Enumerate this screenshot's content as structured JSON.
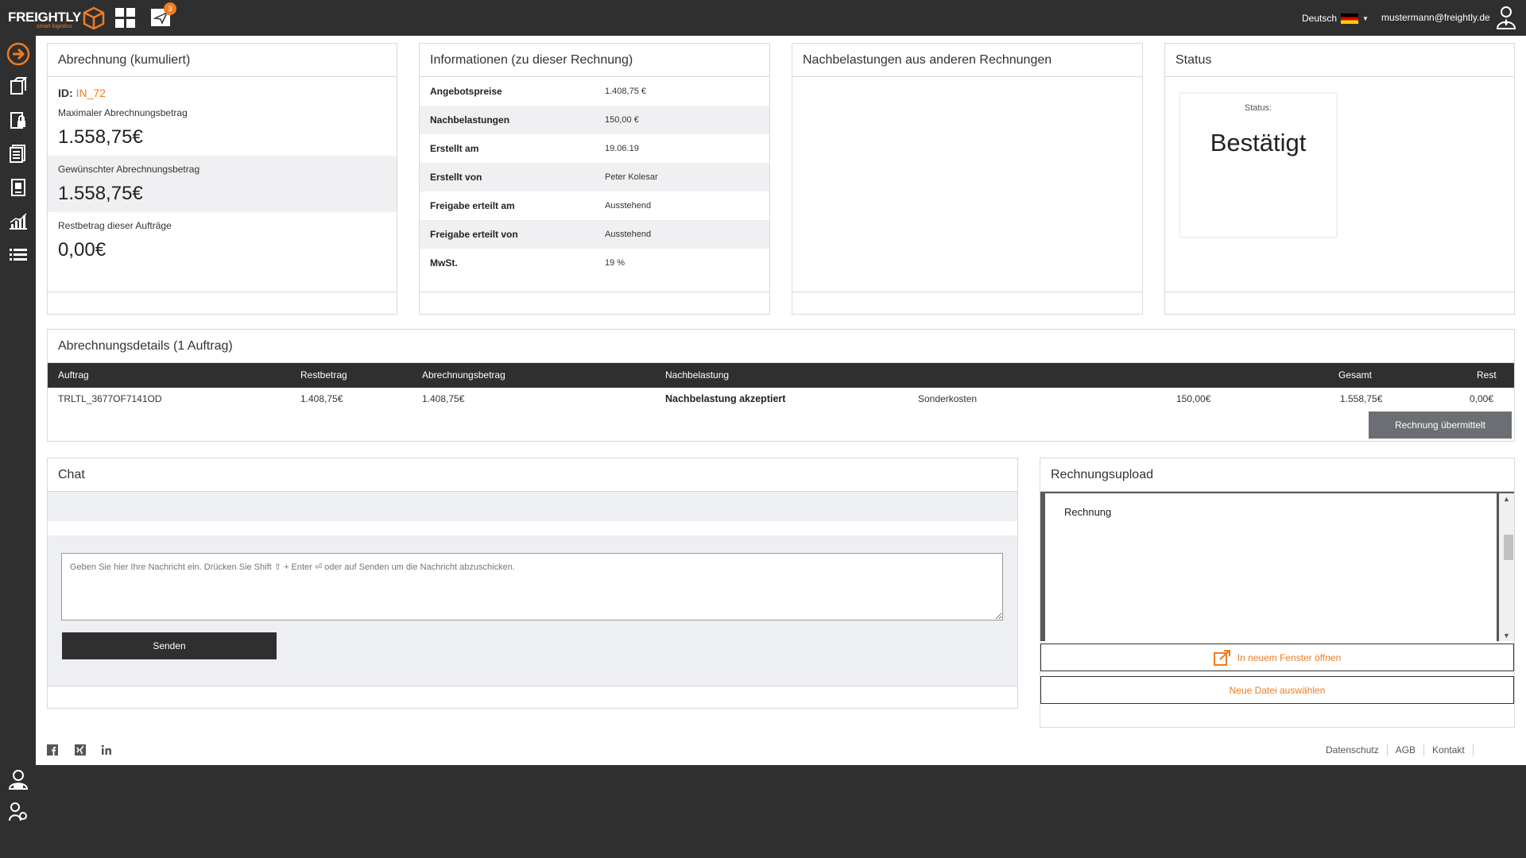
{
  "brand": {
    "name": "FREIGHTLY",
    "tagline": "smart logistics",
    "accent": "#ef7b22",
    "dark": "#2f2f2f"
  },
  "topbar": {
    "notifications_count": "3",
    "language": "Deutsch",
    "user_email": "mustermann@freightly.de"
  },
  "sidebar": {
    "icons": [
      "arrow-right-circle-icon",
      "shipment-icon",
      "lock-document-icon",
      "documents-icon",
      "invoice-icon",
      "chart-icon",
      "list-icon",
      "user-manager-icon",
      "user-settings-icon"
    ]
  },
  "abrechnung": {
    "title": "Abrechnung (kumuliert)",
    "id_label": "ID:",
    "id_value": "IN_72",
    "max_label": "Maximaler Abrechnungsbetrag",
    "max_value": "1.558,75€",
    "wanted_label": "Gewünschter Abrechnungsbetrag",
    "wanted_value": "1.558,75€",
    "rest_label": "Restbetrag dieser Aufträge",
    "rest_value": "0,00€"
  },
  "informationen": {
    "title": "Informationen (zu dieser Rechnung)",
    "rows": [
      {
        "label": "Angebotspreise",
        "value": "1.408,75 €"
      },
      {
        "label": "Nachbelastungen",
        "value": "150,00 €"
      },
      {
        "label": "Erstellt am",
        "value": "19.06.19"
      },
      {
        "label": "Erstellt von",
        "value": "Peter Kolesar"
      },
      {
        "label": "Freigabe erteilt am",
        "value": "Ausstehend"
      },
      {
        "label": "Freigabe erteilt von",
        "value": "Ausstehend"
      },
      {
        "label": "MwSt.",
        "value": "19 %"
      }
    ]
  },
  "nachbelastungen": {
    "title": "Nachbelastungen aus anderen Rechnungen"
  },
  "status": {
    "title": "Status",
    "label": "Status:",
    "value": "Bestätigt"
  },
  "details": {
    "title": "Abrechnungsdetails (1 Auftrag)",
    "columns": {
      "auftrag": "Auftrag",
      "restbetrag": "Restbetrag",
      "abrechnungsbetrag": "Abrechnungsbetrag",
      "nachbelastung": "Nachbelastung",
      "gesamt": "Gesamt",
      "rest": "Rest"
    },
    "row": {
      "auftrag": "TRLTL_3677OF7141OD",
      "restbetrag": "1.408,75€",
      "abrechnungsbetrag": "1.408,75€",
      "nachbelastung_status": "Nachbelastung akzeptiert",
      "nachbelastung_typ": "Sonderkosten",
      "nachbelastung_betrag": "150,00€",
      "gesamt": "1.558,75€",
      "rest": "0,00€"
    },
    "button": "Rechnung übermittelt"
  },
  "chat": {
    "title": "Chat",
    "placeholder": "Geben Sie hier Ihre Nachricht ein. Drücken Sie Shift ⇧ + Enter ⏎ oder auf Senden um die Nachricht abzuschicken.",
    "send_label": "Senden"
  },
  "upload": {
    "title": "Rechnungsupload",
    "document_label": "Rechnung",
    "open_label": "In neuem Fenster öffnen",
    "select_label": "Neue Datei auswählen"
  },
  "footer": {
    "links": [
      "Datenschutz",
      "AGB",
      "Kontakt"
    ],
    "social": [
      "facebook-icon",
      "xing-icon",
      "linkedin-icon"
    ]
  }
}
